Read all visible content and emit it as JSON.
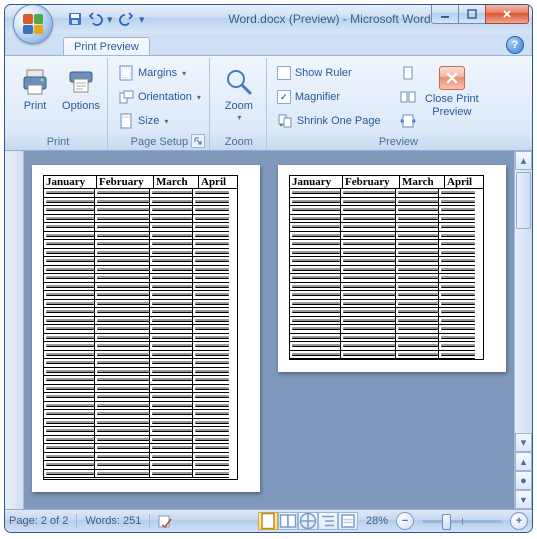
{
  "title": "Word.docx (Preview) - Microsoft Word",
  "tab": "Print Preview",
  "groups": {
    "print": {
      "label": "Print",
      "print_btn": "Print",
      "options_btn": "Options"
    },
    "page_setup": {
      "label": "Page Setup",
      "margins": "Margins",
      "orientation": "Orientation",
      "size": "Size"
    },
    "zoom": {
      "label": "Zoom",
      "zoom_btn": "Zoom"
    },
    "preview": {
      "label": "Preview",
      "show_ruler": "Show Ruler",
      "magnifier": "Magnifier",
      "shrink": "Shrink One Page",
      "close": "Close Print Preview"
    }
  },
  "checks": {
    "show_ruler": false,
    "magnifier": true
  },
  "table_headers": [
    "January",
    "February",
    "March",
    "April"
  ],
  "status": {
    "page": "Page: 2 of 2",
    "words": "Words: 251",
    "zoom": "28%"
  }
}
